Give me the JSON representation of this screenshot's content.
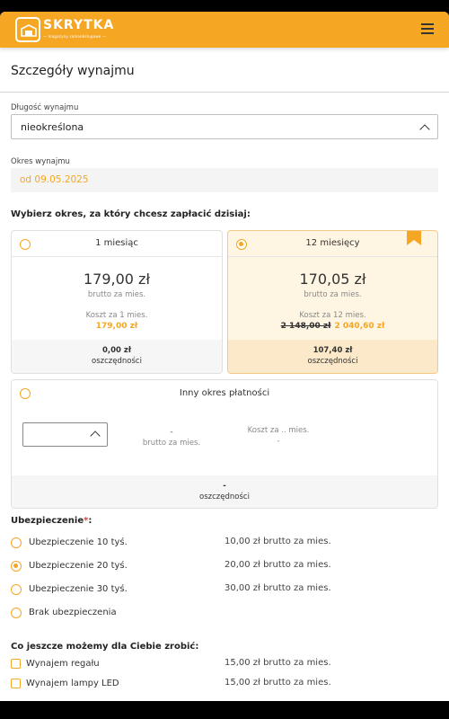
{
  "header": {
    "brand_name": "SKRYTKA",
    "brand_tagline": "— magazyny samoobsługowe —",
    "accent_color": "#f5a623",
    "logo_icon": "storage-box-logo-icon",
    "menu_icon": "hamburger-menu-icon"
  },
  "page": {
    "title": "Szczegóły wynajmu"
  },
  "rental_length": {
    "label": "Długość wynajmu",
    "value": "nieokreślona"
  },
  "rental_period": {
    "label": "Okres wynajmu",
    "value": "od 09.05.2025"
  },
  "plans": {
    "heading": "Wybierz okres, za który chcesz zapłacić dzisiaj:",
    "one_month": {
      "title": "1 miesiąc",
      "price": "179,00 zł",
      "price_note": "brutto za mies.",
      "cost_label": "Koszt za 1 mies.",
      "cost_value": "179,00 zł",
      "savings_value": "0,00 zł",
      "savings_label": "oszczędności",
      "selected": false
    },
    "twelve_months": {
      "title": "12 miesięcy",
      "price": "170,05 zł",
      "price_note": "brutto za mies.",
      "cost_label": "Koszt za 12 mies.",
      "cost_old": "2 148,00 zł",
      "cost_value": "2 040,60 zł",
      "savings_value": "107,40 zł",
      "savings_label": "oszczędności",
      "selected": true
    },
    "other": {
      "title": "Inny okres płatności",
      "price": "-",
      "price_note": "brutto za mies.",
      "cost_label": "Koszt za .. mies.",
      "cost_value": "-",
      "savings_value": "-",
      "savings_label": "oszczędności",
      "selected": false
    }
  },
  "insurance": {
    "heading": "Ubezpieczenie",
    "required_mark": "*",
    "colon": ":",
    "options": [
      {
        "label": "Ubezpieczenie 10 tyś.",
        "price": "10,00 zł brutto za mies.",
        "selected": false
      },
      {
        "label": "Ubezpieczenie 20 tyś.",
        "price": "20,00 zł brutto za mies.",
        "selected": true
      },
      {
        "label": "Ubezpieczenie 30 tyś.",
        "price": "30,00 zł brutto za mies.",
        "selected": false
      },
      {
        "label": "Brak ubezpieczenia",
        "price": "",
        "selected": false
      }
    ]
  },
  "extras": {
    "heading": "Co jeszcze możemy dla Ciebie zrobić:",
    "items": [
      {
        "label": "Wynajem regału",
        "price": "15,00 zł brutto za mies.",
        "checked": false
      },
      {
        "label": "Wynajem lampy LED",
        "price": "15,00 zł brutto za mies.",
        "checked": false
      }
    ]
  }
}
